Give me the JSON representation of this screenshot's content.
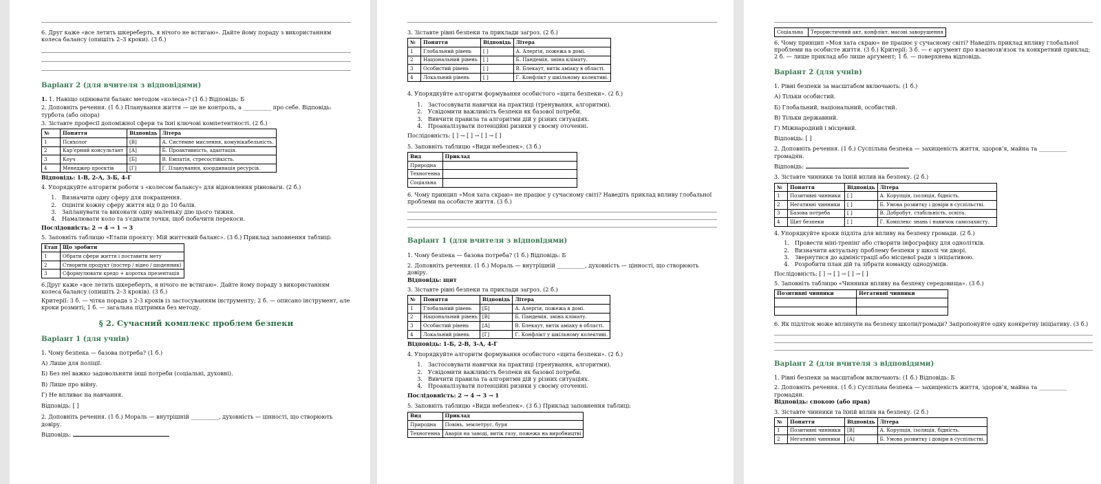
{
  "p1": {
    "q6": "6. Друг каже «все летить шкереберть, я нічого не встигаю». Дайте йому пораду з використанням колеса балансу (опишіть 2–3 кроки). (3 б.)",
    "variant2_title": "Варіант 2 (для вчителя з відповідями)",
    "q1": "1. Навіщо оцінювати баланс методом «колеса»? (1 б.) Відповідь: Б",
    "q2": "2. Доповніть речення. (1 б.) Планування життя — це не контроль, а __________ про себе. Відповідь: турбота (або опора)",
    "q3": "3. Зіставте професії допоміжної сфери та їхні ключові компетентності. (2 б.)",
    "t3_head": [
      "№",
      "Поняття",
      "Відповідь",
      "Літера"
    ],
    "t3_rows": [
      [
        "1",
        "Психолог",
        "[В]",
        "А. Системне мислення, комунікабельність."
      ],
      [
        "2",
        "Кар’єрний консультант",
        "[А]",
        "Б. Проактивність, адаптація."
      ],
      [
        "3",
        "Коуч",
        "[Б]",
        "В. Емпатія, стресостійкість."
      ],
      [
        "4",
        "Менеджер проєктів",
        "[Г]",
        "Г. Планування, координація ресурсів."
      ]
    ],
    "ans3": "Відповідь: 1-В, 2-А, 3-Б, 4-Г",
    "q4": "4. Упорядкуйте алгоритм роботи з «колесом балансу» для відновлення рівноваги. (2 б.)",
    "q4_items": [
      "Визначити одну сферу для покращення.",
      "Оцініти кожну сферу життя від 0 до 10 балів.",
      "Запланувати та виконати одну маленьку дію цього тижня.",
      "Намалювати коло та з'єднати точки, щоб побачити перекоси."
    ],
    "seq4": "Послідовність: 2 → 4 → 1 → 3",
    "q5": "5. Заповніть таблицю «Етапи проєкту: Мій життєвий баланс». (3 б.) Приклад заповнення таблиці:",
    "t5_head": [
      "Етап",
      "Що зробити"
    ],
    "t5_rows": [
      [
        "1",
        "Обрати сфери життя і поставити мету"
      ],
      [
        "2",
        "Створити продукт (постер / відео / щоденник)"
      ],
      [
        "3",
        "Сформулювати кредо + коротка презентація"
      ]
    ],
    "q6b": "6.Друг каже «все летить шкереберть, я нічого не встигаю». Дайте йому пораду з використанням колеса балансу (опишіть 2–3 кроків). (3 б.)",
    "crit": "Критерії: 3 б. — чітка порада з 2-3 кроків із застосуванням інструменту; 2 б. — описано інструмент, але кроки розмиті; 1 б. — загальна підтримка без методу.",
    "section2": "§ 2. Сучасний комплекс проблем безпеки",
    "variant1_title": "Варіант 1 (для учнів)",
    "v1q1": "1. Чому безпека — базова потреба? (1 б.)",
    "v1q1_opts": [
      "А) Лише для поліції.",
      "Б) Без неї важко задовольняти інші потреби (соціальні, духовні).",
      "В) Лише про війну.",
      "Г) Не впливає на навчання."
    ],
    "v1q1_ans": "Відповідь: [   ]",
    "v1q2": "2. Доповніть речення. (1 б.) Мораль — внутрішній __________, духовність — цінності, що створюють довіру.",
    "v1q2_ans": "Відповідь:"
  },
  "p2": {
    "q3": "3. Зіставте рівні безпеки та приклади загроз. (2 б.)",
    "t_head": [
      "№",
      "Поняття",
      "Відповідь",
      "Літера"
    ],
    "t_rows_blank": [
      [
        "1",
        "Глобальний рівень",
        "[   ]",
        "А. Алергія, пожежа в домі."
      ],
      [
        "2",
        "Національний рівень",
        "[   ]",
        "Б. Пандемія, зміна клімату."
      ],
      [
        "3",
        "Особистий рівень",
        "[   ]",
        "В. Блекаут, витік аміаку в області."
      ],
      [
        "4",
        "Локальний рівень",
        "[   ]",
        "Г. Конфлікт у шкільному колективі."
      ]
    ],
    "q4": "4. Упорядкуйте алгоритм формування особистого «щита безпеки». (2 б.)",
    "q4_items": [
      "Застосовувати навички на практиці (тренування, алгоритми).",
      "Усвідомити важливість безпеки як базової потреби.",
      "Вивчити правила та алгоритми дій у різних ситуаціях.",
      "Проаналізувати потенційні ризики у своєму оточенні."
    ],
    "seq_blank": "Послідовність: [   ] → [   ] → [   ] → [   ]",
    "q5": "5. Заповніть таблицю «Види небезпек». (3 б.)",
    "t5_head": [
      "Вид",
      "Приклад"
    ],
    "t5_kinds": [
      "Природна",
      "Техногенна",
      "Соціальна"
    ],
    "q6": "6. Чому принцип «Моя хата скраю» не працює у сучасному світі? Наведіть приклад впливу глобальної проблеми на особисте життя. (3 б.)",
    "variant1t": "Варіант 1 (для вчителя з відповідями)",
    "a1": "1. Чому безпека — базова потреба? (1 б.) Відповідь: Б",
    "a2": "2. Доповніть речення. (1 б.) Мораль — внутрішній __________, духовність — цінності, що створюють довіру.",
    "a2_ans": "Відповідь: щит",
    "a3": "3. Зіставте рівні безпеки та приклади загроз. (2 б.)",
    "t_ans": [
      "[Б]",
      "[В]",
      "[А]",
      "[Г]"
    ],
    "a3_ans": "Відповідь: 1-Б, 2-В, 3-А, 4-Г",
    "a4": "4. Упорядкуйте алгоритм формування особистого «щита безпеки». (2 б.)",
    "a4_seq": "Послідовність: 2 → 4 → 3 → 1",
    "a5": "5. Заповніть таблицю «Види небезпек». (3 б.) Приклад заповнення таблиці:",
    "a5_rows": [
      [
        "Природна",
        "Повінь, землетрус, буря"
      ],
      [
        "Техногенна",
        "Аварія на заводі, витік газу, пожежа на виробництві"
      ]
    ]
  },
  "p3": {
    "top_row": [
      "Соціальна",
      "Терористичний акт, конфлікт, масові заворушення"
    ],
    "q6": "6. Чому принцип «Моя хата скраю» не працює у сучасному світі? Наведіть приклад впливу глобальної проблеми на особисте життя. (3 б.) Критерії: 3 б. — є аргумент про взаємозв'язок та конкретний приклад; 2 б. — лише приклад або лише аргумент; 1 б. — поверхнева відповідь.",
    "variant2s": "Варіант 2 (для учнів)",
    "q1": "1. Рівні безпеки за масштабом включають: (1 б.)",
    "q1_opts": [
      "А) Тільки особистий.",
      "Б) Глобальний, національний, особистий.",
      "В) Тільки державний.",
      "Г) Міжнародний і місцевий."
    ],
    "ans_blank": "Відповідь: [   ]",
    "q2": "2. Доповніть речення. (1 б.) Суспільна безпека — захищеність життя, здоров’я, майна та __________ громадян.",
    "q2_ans": "Відповідь:",
    "q3": "3. Зіставте чинники та їхній вплив на безпеку. (2 б.)",
    "t_head": [
      "№",
      "Поняття",
      "Відповідь",
      "Літера"
    ],
    "t_rows": [
      [
        "1",
        "Позитивні чинники",
        "[   ]",
        "А. Корупція, ізоляція, бідність."
      ],
      [
        "2",
        "Негативні чинники",
        "[   ]",
        "Б. Умова розвитку і довіри в суспільстві."
      ],
      [
        "3",
        "Базова потреба",
        "[   ]",
        "В. Добробут, стабільність, освіта."
      ],
      [
        "4",
        "Щит безпеки",
        "[   ]",
        "Г. Комплекс знань і навичок самозахисту."
      ]
    ],
    "q4": "4. Упорядкуйте кроки підліта для впливу на безпеку громади. (2 б.)",
    "q4_items": [
      "Провести міні-тренінг або створити інфографіку для однолітків.",
      "Визначити актуальну проблему безпеки у школі чи дворі.",
      "Звернутися до адміністрації або місцевої ради з ініціативою.",
      "Розробити план дій та зібрати команду однодумців."
    ],
    "seq_blank": "Послідовність: [   ] → [   ] → [   ] → [   ]",
    "q5": "5. Заповніть таблицю «Чинники впливу на безпеку середовища». (3 б.)",
    "t5_head": [
      "Позитивні чинники",
      "Негативні чинники"
    ],
    "q6b": "6. Як підліток може вплинути на безпеку школи/громади? Запропонуйте одну конкретну ініціативу. (3 б.)",
    "variant2t": "Варіант 2 (для вчителя з відповідями)",
    "a1": "1. Рівні безпеки за масштабом включають: (1 б.) Відповідь: Б",
    "a2": "2. Доповніть речення. (1 б.) Суспільна безпека — захищеність життя, здоров’я, майна та __________ громадян.",
    "a2_ans": "Відповідь: спокою (або прав)",
    "a3": "3. Зіставте чинники та їхній вплив на безпеку. (2 б.)",
    "a_rows": [
      [
        "1",
        "Позитивні чинники",
        "[В]",
        "А. Корупція, ізоляція, бідність."
      ],
      [
        "2",
        "Негативні чинники",
        "[А]",
        "Б. Умова розвитку і довіри в суспільстві."
      ]
    ]
  }
}
